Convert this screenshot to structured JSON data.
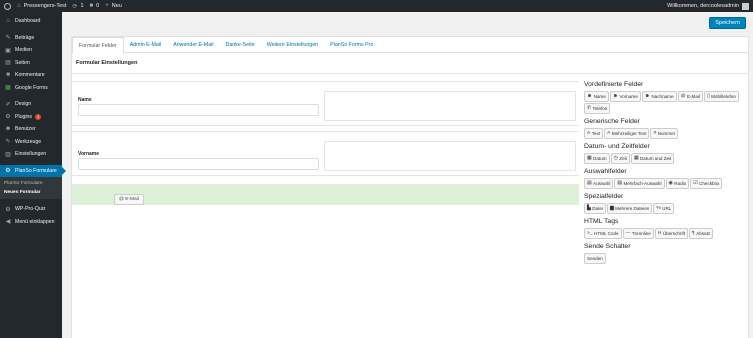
{
  "adminbar": {
    "site_name": "Pressengers-Test",
    "updates_count": "1",
    "comments_count": "0",
    "new_label": "Neu",
    "greeting": "Willkommen, dercoolesadmin"
  },
  "sidebar": {
    "items": [
      {
        "label": "Dashboard",
        "icon": "dashboard-icon",
        "glyph": "⌂"
      },
      {
        "label": "Beiträge",
        "icon": "pin-icon",
        "glyph": "✎"
      },
      {
        "label": "Medien",
        "icon": "media-icon",
        "glyph": "▣"
      },
      {
        "label": "Seiten",
        "icon": "pages-icon",
        "glyph": "▤"
      },
      {
        "label": "Kommentare",
        "icon": "comments-icon",
        "glyph": "■"
      },
      {
        "label": "Google Forms",
        "icon": "google-forms-icon",
        "glyph": "▦"
      },
      {
        "label": "Design",
        "icon": "design-icon",
        "glyph": "✐"
      },
      {
        "label": "Plugins",
        "icon": "plugins-icon",
        "glyph": "⚙",
        "badge": "1"
      },
      {
        "label": "Benutzer",
        "icon": "users-icon",
        "glyph": "☻"
      },
      {
        "label": "Werkzeuge",
        "icon": "tools-icon",
        "glyph": "✎"
      },
      {
        "label": "Einstellungen",
        "icon": "settings-icon",
        "glyph": "▥"
      },
      {
        "label": "PlanSo Formulare",
        "icon": "planso-icon",
        "glyph": "⚙"
      }
    ],
    "submenu": [
      "PlanSo Formulare",
      "Neues Formular"
    ],
    "after": [
      {
        "label": "WP-Pro-Quiz",
        "icon": "quiz-icon",
        "glyph": "⚙"
      },
      {
        "label": "Menü einklappen",
        "icon": "collapse-icon",
        "glyph": "◀"
      }
    ]
  },
  "toolbar": {
    "save_label": "Speichern"
  },
  "tabs": [
    "Formular Felder",
    "Admin E-Mail",
    "Anwender E-Mail",
    "Danke-Seite",
    "Weitere Einstellungen",
    "PlanSo Forms Pro"
  ],
  "section_title": "Formular Einstellungen",
  "fields": [
    {
      "label": "Name"
    },
    {
      "label": "Vorname"
    }
  ],
  "drop_chip": "E-Mail",
  "palette": [
    {
      "title": "Vordefinierte Felder",
      "buttons": [
        {
          "icon": "user-icon",
          "glyph": "☻",
          "label": "Name"
        },
        {
          "icon": "user-icon",
          "glyph": "☻",
          "label": "Vorname"
        },
        {
          "icon": "user-icon",
          "glyph": "☻",
          "label": "Nachname"
        },
        {
          "icon": "at-icon",
          "glyph": "@",
          "label": "E-Mail"
        },
        {
          "icon": "mobile-icon",
          "glyph": "▯",
          "label": "Mobiltelefon"
        },
        {
          "icon": "phone-icon",
          "glyph": "✆",
          "label": "Telefon"
        }
      ]
    },
    {
      "title": "Generische Felder",
      "buttons": [
        {
          "icon": "text-icon",
          "glyph": "A",
          "label": "Text"
        },
        {
          "icon": "text-icon",
          "glyph": "A",
          "label": "Mehrzeiliger Text"
        },
        {
          "icon": "hash-icon",
          "glyph": "#",
          "label": "Nummer"
        }
      ]
    },
    {
      "title": "Datum- und Zeitfelder",
      "buttons": [
        {
          "icon": "calendar-icon",
          "glyph": "▦",
          "label": "Datum"
        },
        {
          "icon": "clock-icon",
          "glyph": "◷",
          "label": "Zeit"
        },
        {
          "icon": "calendar-icon",
          "glyph": "▦",
          "label": "Datum und Zeit"
        }
      ]
    },
    {
      "title": "Auswahlfelder",
      "buttons": [
        {
          "icon": "list-icon",
          "glyph": "▤",
          "label": "Auswahl"
        },
        {
          "icon": "list-icon",
          "glyph": "▤",
          "label": "Mehrfach-Auswahl"
        },
        {
          "icon": "radio-icon",
          "glyph": "◉",
          "label": "Radio"
        },
        {
          "icon": "checkbox-icon",
          "glyph": "☑",
          "label": "Checkbox"
        }
      ]
    },
    {
      "title": "Spezialfelder",
      "buttons": [
        {
          "icon": "file-icon",
          "glyph": "▙",
          "label": "Datei"
        },
        {
          "icon": "folder-icon",
          "glyph": "▆",
          "label": "Mehrere Dateien"
        },
        {
          "icon": "link-icon",
          "glyph": "%",
          "label": "URL"
        }
      ]
    },
    {
      "title": "HTML Tags",
      "buttons": [
        {
          "icon": "code-icon",
          "glyph": ">_",
          "label": "HTML Code"
        },
        {
          "icon": "minus-icon",
          "glyph": "—",
          "label": "Trennline"
        },
        {
          "icon": "header-icon",
          "glyph": "H",
          "label": "Überschrift"
        },
        {
          "icon": "paragraph-icon",
          "glyph": "¶",
          "label": "Absatz"
        }
      ]
    },
    {
      "title": "Sende Schalter",
      "buttons": [
        {
          "icon": "",
          "glyph": "",
          "label": "Senden"
        }
      ]
    }
  ]
}
